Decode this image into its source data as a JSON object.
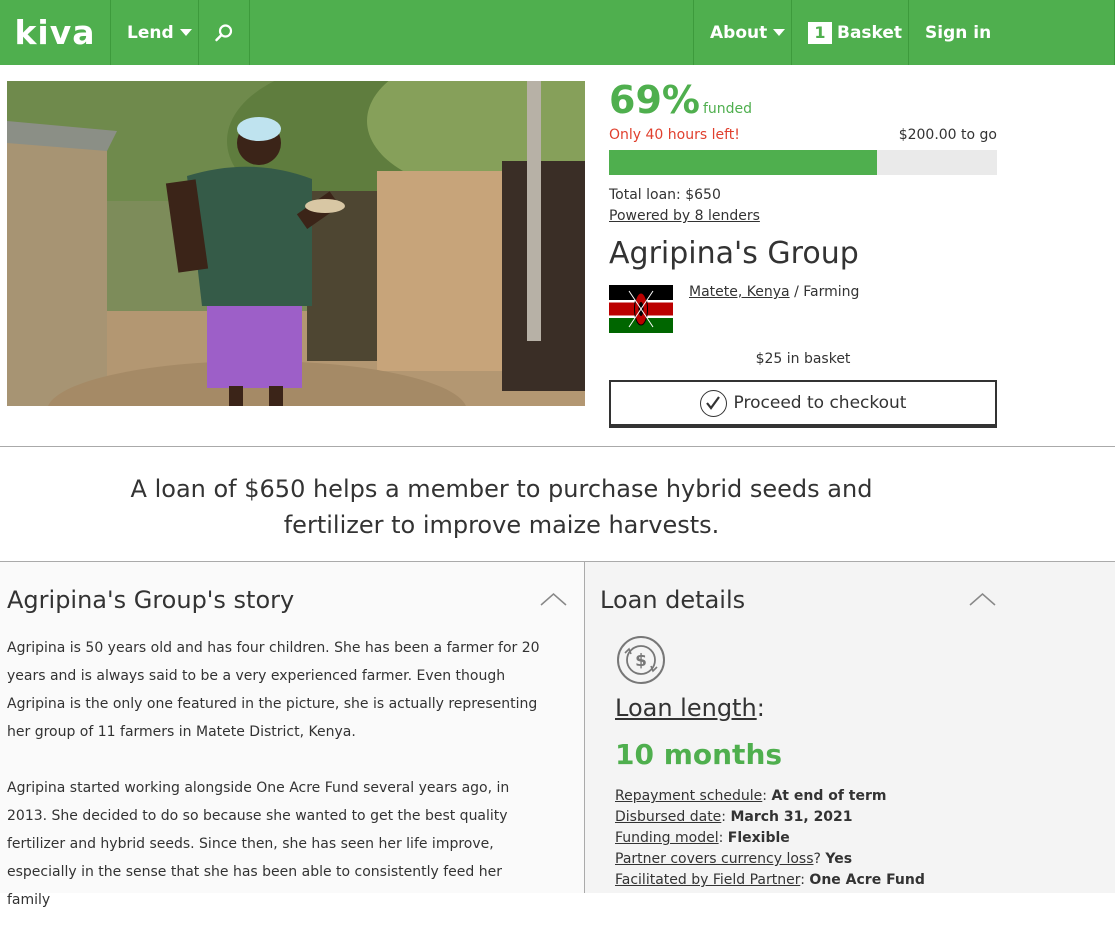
{
  "nav": {
    "logo": "kiva",
    "lend": "Lend",
    "about": "About",
    "basket_count": "1",
    "basket": "Basket",
    "signin": "Sign in"
  },
  "colors": {
    "brand": "#4faf4e",
    "warning": "#e0402e"
  },
  "funding": {
    "percent": "69%",
    "percent_value": 69,
    "funded_label": "funded",
    "time_left": "Only 40 hours left!",
    "to_go": "$200.00 to go",
    "total_loan": "Total loan: $650",
    "lenders": "Powered by 8 lenders"
  },
  "borrower": {
    "name": "Agripina's Group",
    "location": "Matete, Kenya",
    "sector": "/ Farming",
    "in_basket": "$25 in basket",
    "checkout_label": "Proceed to checkout"
  },
  "loan_use": "A loan of $650 helps a member to purchase hybrid seeds and fertilizer to improve maize harvests.",
  "story": {
    "title": "Agripina's Group's story",
    "paragraphs": [
      "Agripina is 50 years old and has four children. She has been a farmer for 20 years and is always said to be a very experienced farmer. Even though Agripina is the only one featured in the picture, she is actually representing her group of 11 farmers in Matete District, Kenya.",
      "Agripina started working alongside One Acre Fund several years ago, in 2013. She decided to do so because she wanted to get the best quality fertilizer and hybrid seeds. Since then, she has seen her life improve, especially in the sense that she has been able to consistently feed her family"
    ]
  },
  "details": {
    "title": "Loan details",
    "length_label": "Loan length",
    "length_value": "10 months",
    "facts": [
      {
        "label": "Repayment schedule",
        "sep": ": ",
        "value": "At end of term"
      },
      {
        "label": "Disbursed date",
        "sep": ": ",
        "value": "March 31, 2021"
      },
      {
        "label": "Funding model",
        "sep": ": ",
        "value": "Flexible"
      },
      {
        "label": "Partner covers currency loss",
        "sep": "? ",
        "value": "Yes"
      },
      {
        "label": "Facilitated by Field Partner",
        "sep": ": ",
        "value": "One Acre Fund"
      }
    ]
  },
  "icons": [
    "search-icon",
    "caret-down-icon",
    "checkmark-icon",
    "chevron-up-icon",
    "currency-exchange-icon",
    "kenya-flag"
  ]
}
